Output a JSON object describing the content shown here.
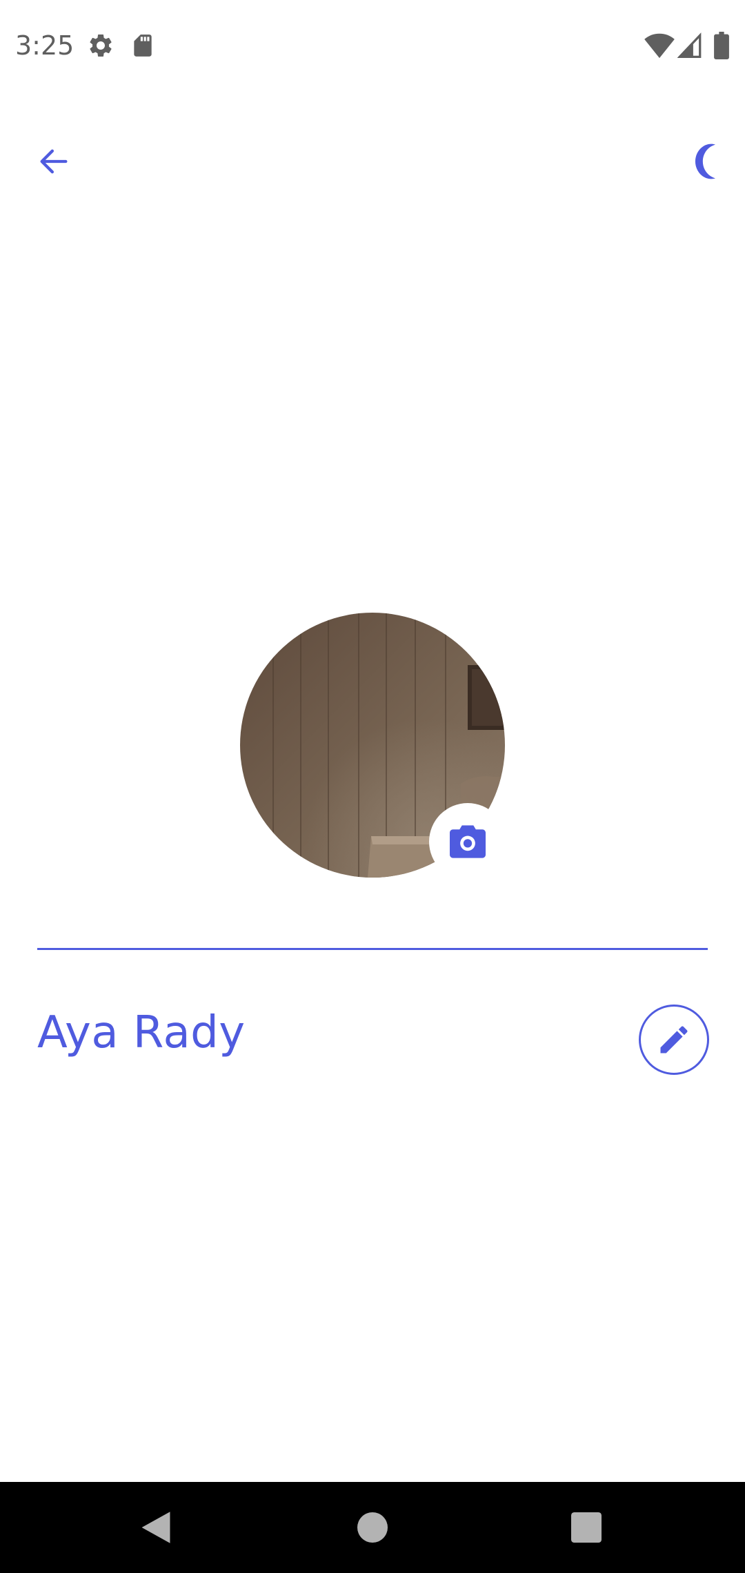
{
  "status_bar": {
    "time": "3:25",
    "icons": [
      "settings-icon",
      "sd-card-icon",
      "wifi-icon",
      "signal-icon",
      "battery-icon"
    ]
  },
  "app_bar": {
    "back_icon": "arrow-back-icon",
    "theme_icon": "moon-icon"
  },
  "profile": {
    "name": "Aya Rady",
    "avatar_icon": "profile-photo",
    "camera_icon": "camera-icon",
    "edit_icon": "pencil-icon"
  },
  "nav_bar": {
    "icons": [
      "nav-back-icon",
      "nav-home-icon",
      "nav-recents-icon"
    ]
  },
  "colors": {
    "accent": "#4f5bdf",
    "status_icon": "#5f5f5f",
    "nav_icon": "#b3b3b3",
    "nav_background": "#000000",
    "background": "#ffffff"
  }
}
